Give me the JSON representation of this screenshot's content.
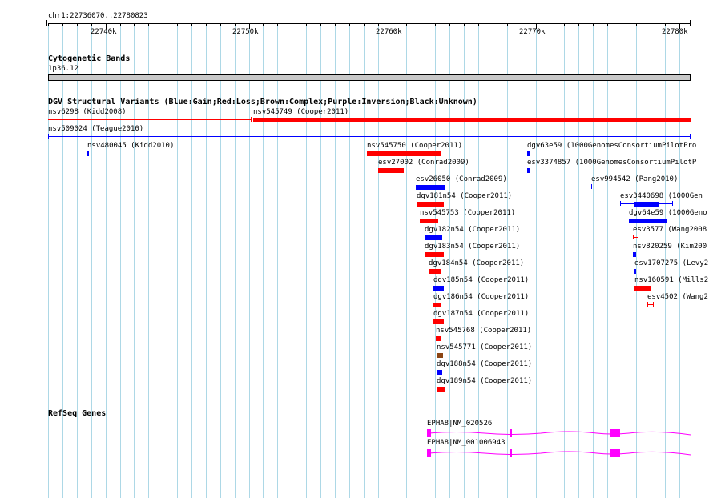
{
  "ruler": {
    "range_label": "chr1:22736070..22780823",
    "ticks": [
      "22740k",
      "22750k",
      "22760k",
      "22770k",
      "22780k"
    ]
  },
  "cyto": {
    "title": "Cytogenetic Bands",
    "band": "1p36.12"
  },
  "dgv": {
    "title": "DGV Structural Variants (Blue:Gain;Red:Loss;Brown:Complex;Purple:Inversion;Black:Unknown)",
    "features": [
      {
        "id": "nsv6298 (Kidd2008)"
      },
      {
        "id": "nsv545749 (Cooper2011)"
      },
      {
        "id": "nsv509024 (Teague2010)"
      },
      {
        "id": "nsv480045 (Kidd2010)"
      },
      {
        "id": "nsv545750 (Cooper2011)"
      },
      {
        "id": "dgv63e59 (1000GenomesConsortiumPilotPro"
      },
      {
        "id": "esv27002 (Conrad2009)"
      },
      {
        "id": "esv3374857 (1000GenomesConsortiumPilotP"
      },
      {
        "id": "esv26050 (Conrad2009)"
      },
      {
        "id": "esv994542 (Pang2010)"
      },
      {
        "id": "dgv181n54 (Cooper2011)"
      },
      {
        "id": "esv3440698 (1000Gen"
      },
      {
        "id": "nsv545753 (Cooper2011)"
      },
      {
        "id": "dgv64e59 (1000Geno"
      },
      {
        "id": "dgv182n54 (Cooper2011)"
      },
      {
        "id": "esv3577 (Wang2008"
      },
      {
        "id": "dgv183n54 (Cooper2011)"
      },
      {
        "id": "nsv820259 (Kim200"
      },
      {
        "id": "dgv184n54 (Cooper2011)"
      },
      {
        "id": "esv1707275 (Levy2"
      },
      {
        "id": "dgv185n54 (Cooper2011)"
      },
      {
        "id": "nsv160591 (Mills2"
      },
      {
        "id": "dgv186n54 (Cooper2011)"
      },
      {
        "id": "esv4502 (Wang2"
      },
      {
        "id": "dgv187n54 (Cooper2011)"
      },
      {
        "id": "nsv545768 (Cooper2011)"
      },
      {
        "id": "nsv545771 (Cooper2011)"
      },
      {
        "id": "dgv188n54 (Cooper2011)"
      },
      {
        "id": "dgv189n54 (Cooper2011)"
      }
    ]
  },
  "refseq": {
    "title": "RefSeq Genes",
    "genes": [
      "EPHA8|NM_020526",
      "EPHA8|NM_001006943"
    ]
  },
  "colors": {
    "gain": "#0000ff",
    "loss": "#ff0000",
    "complex": "#8b4513",
    "gene": "#ff00ff",
    "grid": "#add8e6"
  }
}
